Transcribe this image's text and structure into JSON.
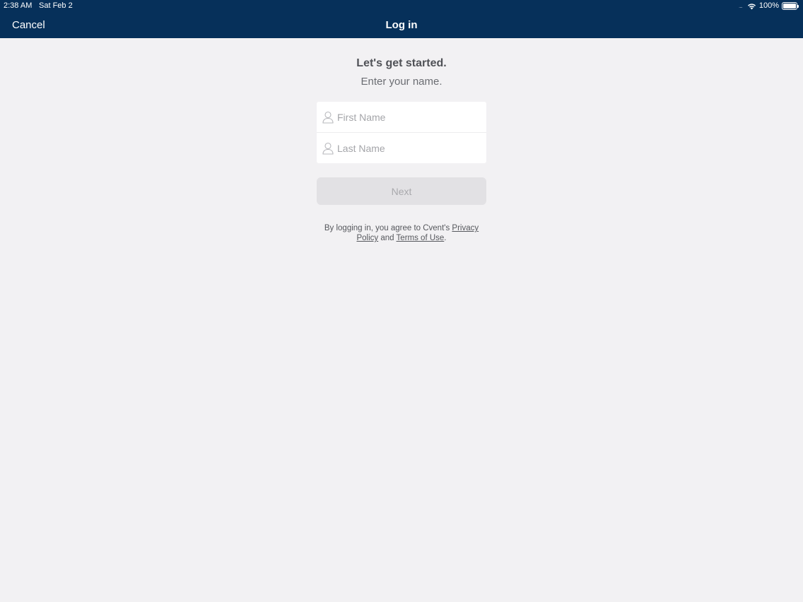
{
  "status_bar": {
    "time": "2:38 AM",
    "date": "Sat Feb 2",
    "signal": "....",
    "battery_percent": "100%",
    "battery_level": 1.0
  },
  "nav": {
    "cancel_label": "Cancel",
    "title": "Log in",
    "background_color": "#06305a"
  },
  "form": {
    "headline": "Let's get started.",
    "subheadline": "Enter your name.",
    "first_name": {
      "placeholder": "First Name",
      "value": "",
      "icon": "user-icon"
    },
    "last_name": {
      "placeholder": "Last Name",
      "value": "",
      "icon": "user-icon"
    },
    "next_label": "Next"
  },
  "legal": {
    "prefix": "By logging in, you agree to Cvent's ",
    "privacy_link": "Privacy Policy",
    "conjunction": " and ",
    "terms_link": "Terms of Use",
    "suffix": "."
  }
}
